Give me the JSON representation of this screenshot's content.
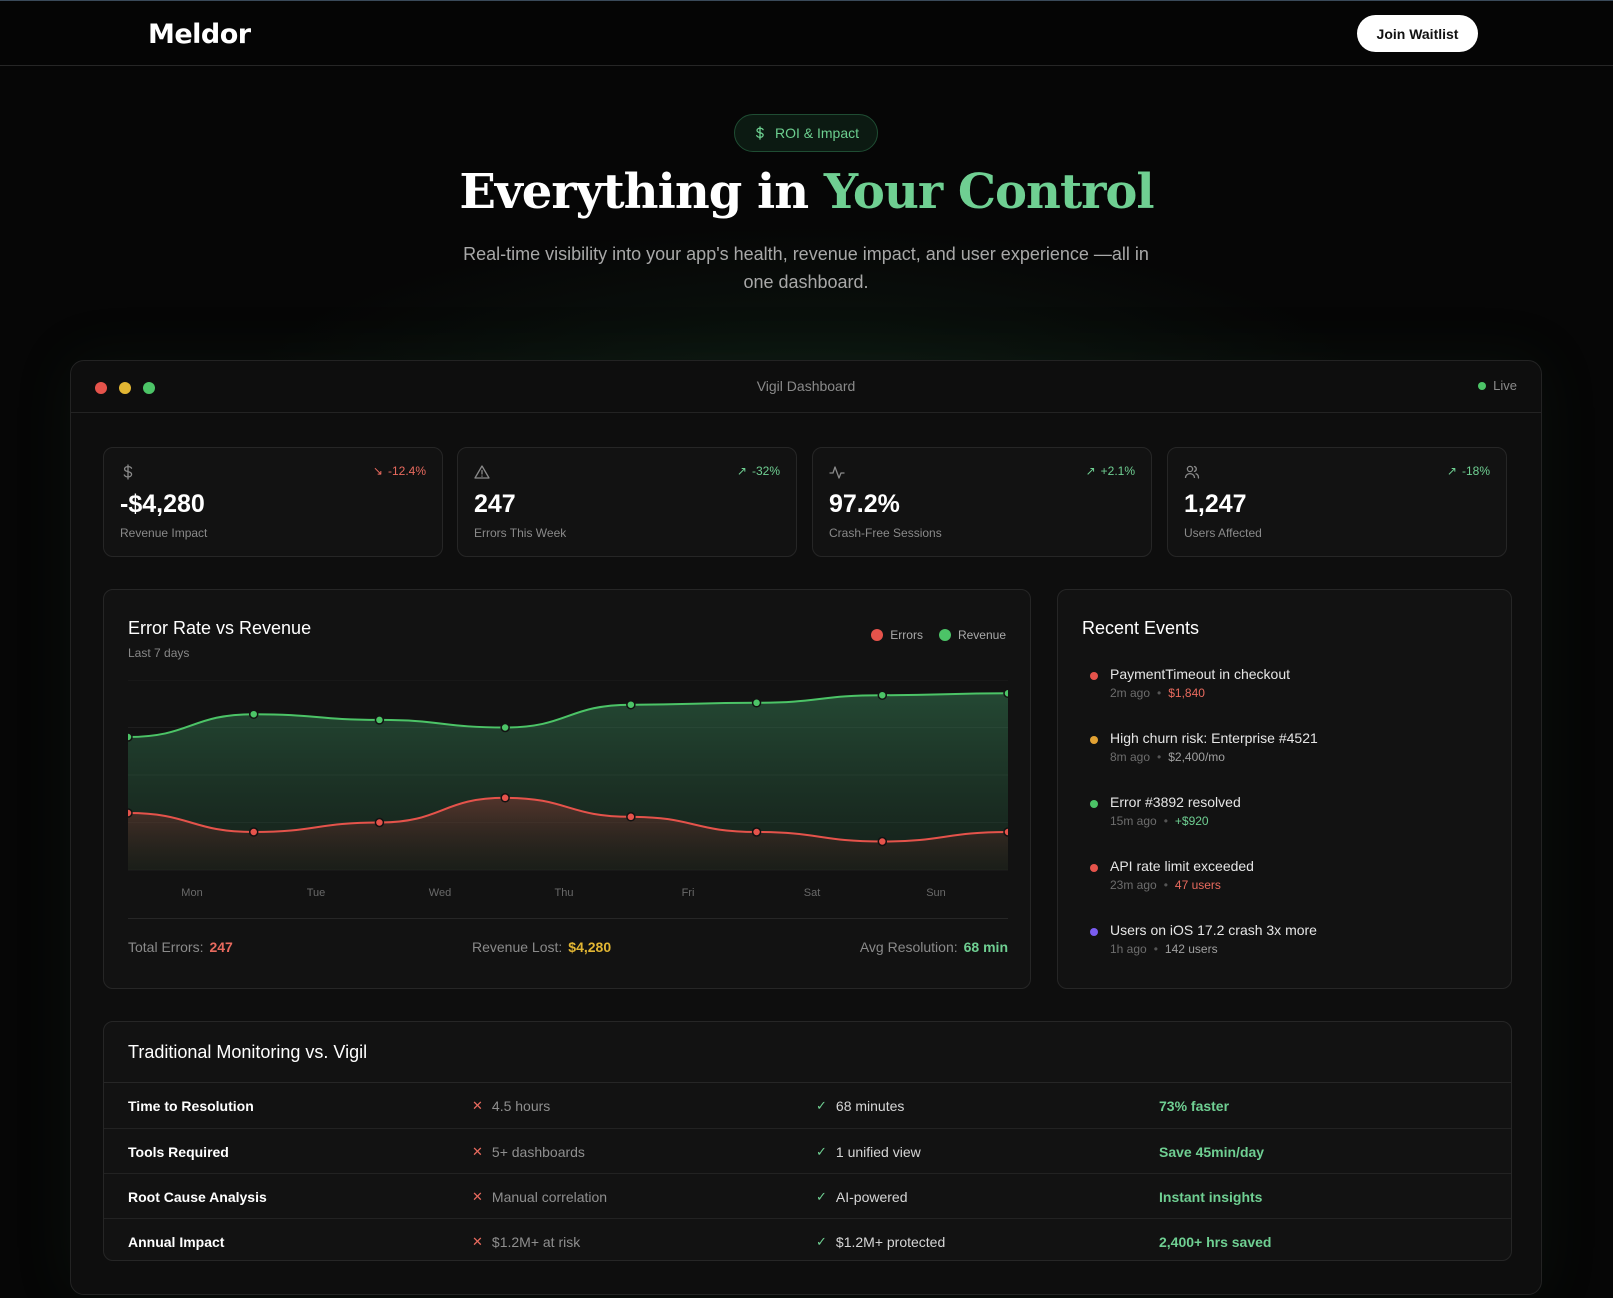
{
  "nav": {
    "logo_text": "Meldor",
    "cta_label": "Join Waitlist"
  },
  "hero": {
    "badge_label": "ROI & Impact",
    "title_lead": "Everything in ",
    "title_accent": "Your Control",
    "subtitle": "Real-time visibility into your app's health, revenue impact, and user experience —all in one dashboard."
  },
  "dashboard": {
    "window_title": "Vigil Dashboard",
    "live_label": "Live",
    "stats": [
      {
        "icon": "dollar-icon",
        "change": "-12.4%",
        "trend": "down",
        "value": "-$4,280",
        "label": "Revenue Impact"
      },
      {
        "icon": "warning-icon",
        "change": "-32%",
        "trend": "up",
        "value": "247",
        "label": "Errors This Week"
      },
      {
        "icon": "activity-icon",
        "change": "+2.1%",
        "trend": "up",
        "value": "97.2%",
        "label": "Crash-Free Sessions"
      },
      {
        "icon": "users-icon",
        "change": "-18%",
        "trend": "up",
        "value": "1,247",
        "label": "Users Affected"
      }
    ],
    "chart_panel": {
      "title": "Error Rate vs Revenue",
      "subtitle": "Last 7 days",
      "legend": [
        "Errors",
        "Revenue"
      ],
      "footer": {
        "total_errors_label": "Total Errors:",
        "total_errors_value": "247",
        "revenue_lost_label": "Revenue Lost:",
        "revenue_lost_value": "$4,280",
        "avg_resolution_label": "Avg Resolution:",
        "avg_resolution_value": "68 min"
      }
    },
    "events_panel": {
      "title": "Recent Events",
      "events": [
        {
          "title": "PaymentTimeout in checkout",
          "time": "2m ago",
          "detail": "$1,840",
          "color": "#e5534b",
          "detail_color": "#e86a5e"
        },
        {
          "title": "High churn risk: Enterprise #4521",
          "time": "8m ago",
          "detail": "$2,400/mo",
          "color": "#e2a233",
          "detail_color": "#a0a0a0"
        },
        {
          "title": "Error #3892 resolved",
          "time": "15m ago",
          "detail": "+$920",
          "color": "#4cc467",
          "detail_color": "#6fcf92"
        },
        {
          "title": "API rate limit exceeded",
          "time": "23m ago",
          "detail": "47 users",
          "color": "#e5534b",
          "detail_color": "#e86a5e"
        },
        {
          "title": "Users on iOS 17.2 crash 3x more",
          "time": "1h ago",
          "detail": "142 users",
          "color": "#7a5cf0",
          "detail_color": "#a0a0a0"
        }
      ]
    },
    "comparison": {
      "title": "Traditional Monitoring vs. Vigil",
      "rows": [
        {
          "metric": "Time to Resolution",
          "traditional": "4.5 hours",
          "vigil": "68 minutes",
          "benefit": "73% faster"
        },
        {
          "metric": "Tools Required",
          "traditional": "5+ dashboards",
          "vigil": "1 unified view",
          "benefit": "Save 45min/day"
        },
        {
          "metric": "Root Cause Analysis",
          "traditional": "Manual correlation",
          "vigil": "AI-powered",
          "benefit": "Instant insights"
        },
        {
          "metric": "Annual Impact",
          "traditional": "$1.2M+ at risk",
          "vigil": "$1.2M+ protected",
          "benefit": "2,400+ hrs saved"
        }
      ]
    }
  },
  "colors": {
    "accent_green": "#6fcf92",
    "error_red": "#e5534b",
    "warning_yellow": "#e2b633"
  },
  "chart_data": {
    "type": "area",
    "x": [
      "Mon",
      "Tue",
      "Wed",
      "Thu",
      "Fri",
      "Sat",
      "Sun"
    ],
    "series": [
      {
        "name": "Errors",
        "color": "#e5534b",
        "values": [
          30,
          20,
          25,
          38,
          28,
          20,
          15,
          20
        ]
      },
      {
        "name": "Revenue",
        "color": "#4cc467",
        "values": [
          70,
          82,
          79,
          75,
          87,
          88,
          92,
          93
        ]
      }
    ],
    "ylim": [
      0,
      100
    ],
    "grid": true,
    "legend": "top-right"
  }
}
